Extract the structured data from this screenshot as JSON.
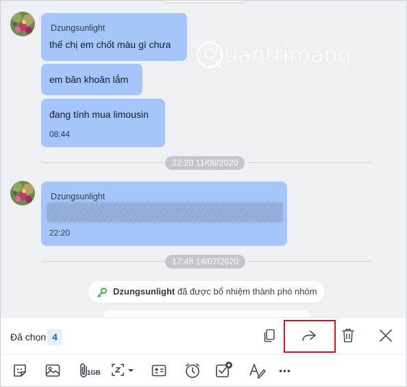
{
  "chat": {
    "group1": {
      "sender": "Dzungsunlight",
      "messages": [
        {
          "text": "thế chị em chốt màu gì chưa"
        },
        {
          "text": "em băn khoăn lắm"
        },
        {
          "text": "đang tính mua limousin",
          "time": "08:44"
        }
      ]
    },
    "separator1": "22:20 11/06/2020",
    "group2": {
      "sender": "Dzungsunlight",
      "time": "22:20"
    },
    "separator2": "17:48 14/07/2020",
    "notice": {
      "name": "Dzungsunlight",
      "text": " đã được bổ nhiệm thành phó nhóm"
    },
    "watermark": "uantrimang"
  },
  "selection_bar": {
    "label": "Đã chọn",
    "count": "4",
    "actions": [
      "copy-icon",
      "forward-icon",
      "trash-icon",
      "close-icon"
    ]
  },
  "toolbar": {
    "tools": [
      "sticker-icon",
      "image-icon",
      "attach-icon",
      "screenshot-icon",
      "contact-card-icon",
      "reminder-clock-icon",
      "task-icon",
      "format-text-icon",
      "more-icon"
    ],
    "attach_limit": "1GB",
    "more_label": "•••"
  },
  "colors": {
    "bubble": "#a6c6fb",
    "background": "#eef0f4",
    "highlight": "#d0101c",
    "count_badge": "#1a63d6"
  }
}
